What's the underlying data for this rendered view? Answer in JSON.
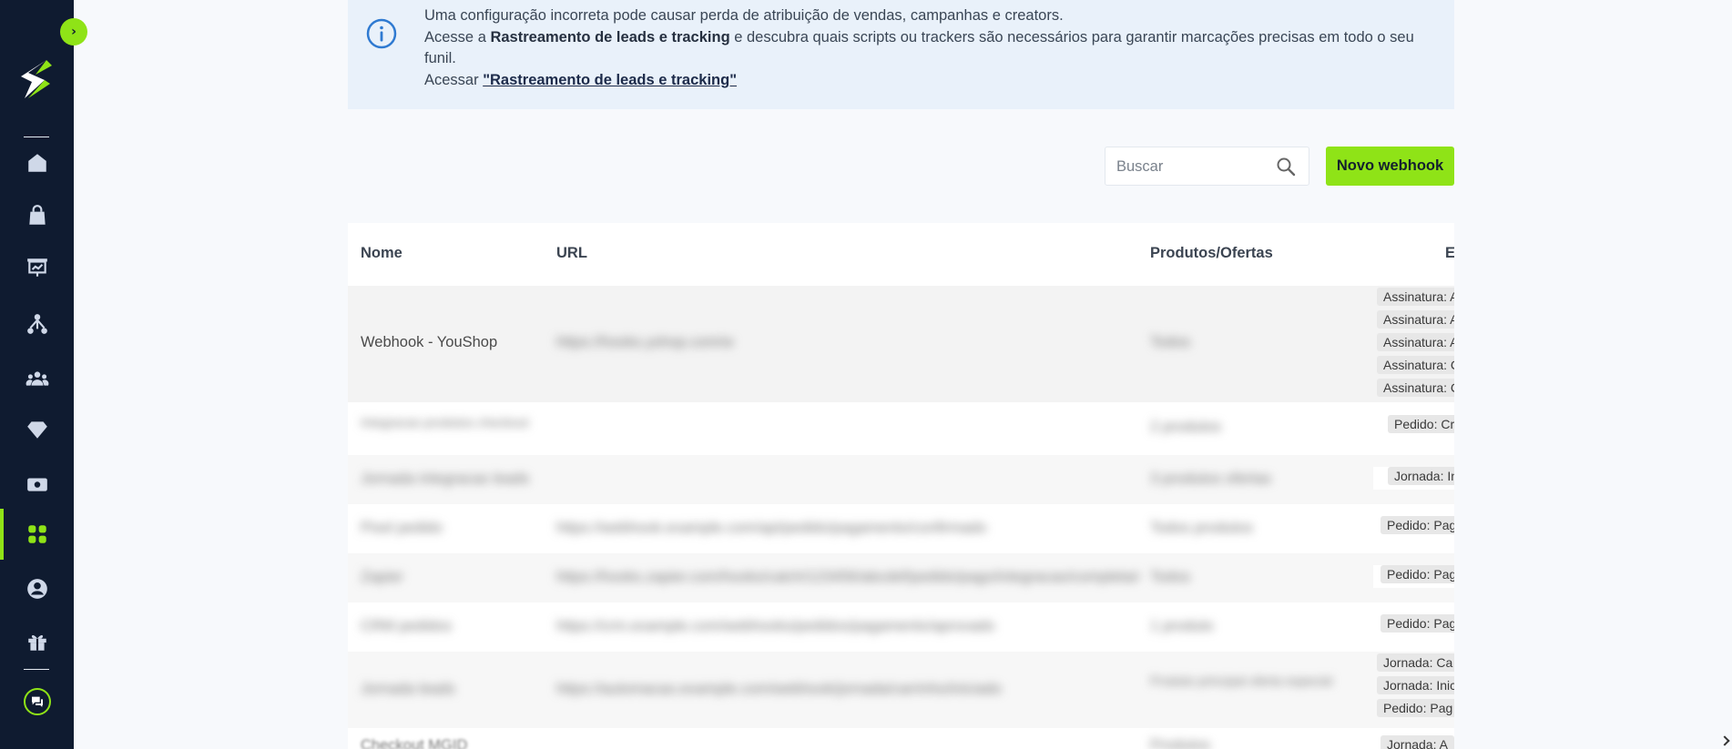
{
  "sidebar": {
    "toggle_glyph": "›",
    "items": [
      {
        "name": "home-icon"
      },
      {
        "name": "shopping-bag-icon"
      },
      {
        "name": "presentation-chart-icon"
      },
      {
        "name": "network-tree-icon"
      },
      {
        "name": "users-group-icon"
      },
      {
        "name": "diamond-icon"
      },
      {
        "name": "money-icon"
      },
      {
        "name": "apps-grid-icon",
        "active": true
      },
      {
        "name": "user-circle-icon"
      },
      {
        "name": "gift-icon"
      }
    ],
    "accent": "#8fe317",
    "background": "#0f1b30"
  },
  "banner": {
    "line1": "Uma configuração incorreta pode causar perda de atribuição de vendas, campanhas e creators.",
    "line2_prefix": "Acesse a ",
    "line2_bold": "Rastreamento de leads e tracking",
    "line2_suffix": " e descubra quais scripts ou trackers são necessários para garantir marcações precisas em todo o seu funil.",
    "line3_prefix": "Acessar ",
    "line3_link": "\"Rastreamento de leads e tracking\""
  },
  "toolbar": {
    "search_placeholder": "Buscar",
    "new_button_label": "Novo webhook"
  },
  "table": {
    "headers": {
      "name": "Nome",
      "url": "URL",
      "products": "Produtos/Ofertas",
      "events": "E"
    },
    "rows": [
      {
        "name": "Webhook - YouShop",
        "url": "https://hooks.yshop.com/w",
        "products": "Todos",
        "events": [
          "Assinatura: A",
          "Assinatura: A",
          "Assinatura: A",
          "Assinatura: C",
          "Assinatura: C"
        ]
      },
      {
        "name": "Integracao produtos checkout",
        "url": "",
        "products": "2 produtos",
        "events": [
          "Pedido: Cr"
        ]
      },
      {
        "name": "Jornada integracao leads",
        "url": "",
        "products": "3 produtos ofertas",
        "events": [
          "Jornada: In"
        ]
      },
      {
        "name": "Pixel pedido",
        "url": "https://webhook.example.com/api/pedido/pagamento/confirmado",
        "products": "Todos produtos",
        "events": [
          "Pedido: Pag"
        ]
      },
      {
        "name": "Zapier",
        "url": "https://hooks.zapier.com/hooks/catch/123456/abcdef/pedido/pago/integracao/completa/evento",
        "products": "Todos",
        "events": [
          "Pedido: Pag"
        ]
      },
      {
        "name": "CRM pedidos",
        "url": "https://crm.example.com/webhooks/pedidos/pagamento/aprovado",
        "products": "1 produto",
        "events": [
          "Pedido: Pag"
        ]
      },
      {
        "name": "Jornada leads",
        "url": "https://automacao.example.com/webhook/jornada/carrinho/iniciado",
        "products": "Produto principal oferta especial",
        "events": [
          "Jornada: Ca",
          "Jornada: Inic",
          "Pedido: Pag"
        ]
      },
      {
        "name": "Checkout MGID",
        "url": "",
        "products": "Produtos",
        "events": [
          "Jornada: A"
        ]
      }
    ]
  }
}
